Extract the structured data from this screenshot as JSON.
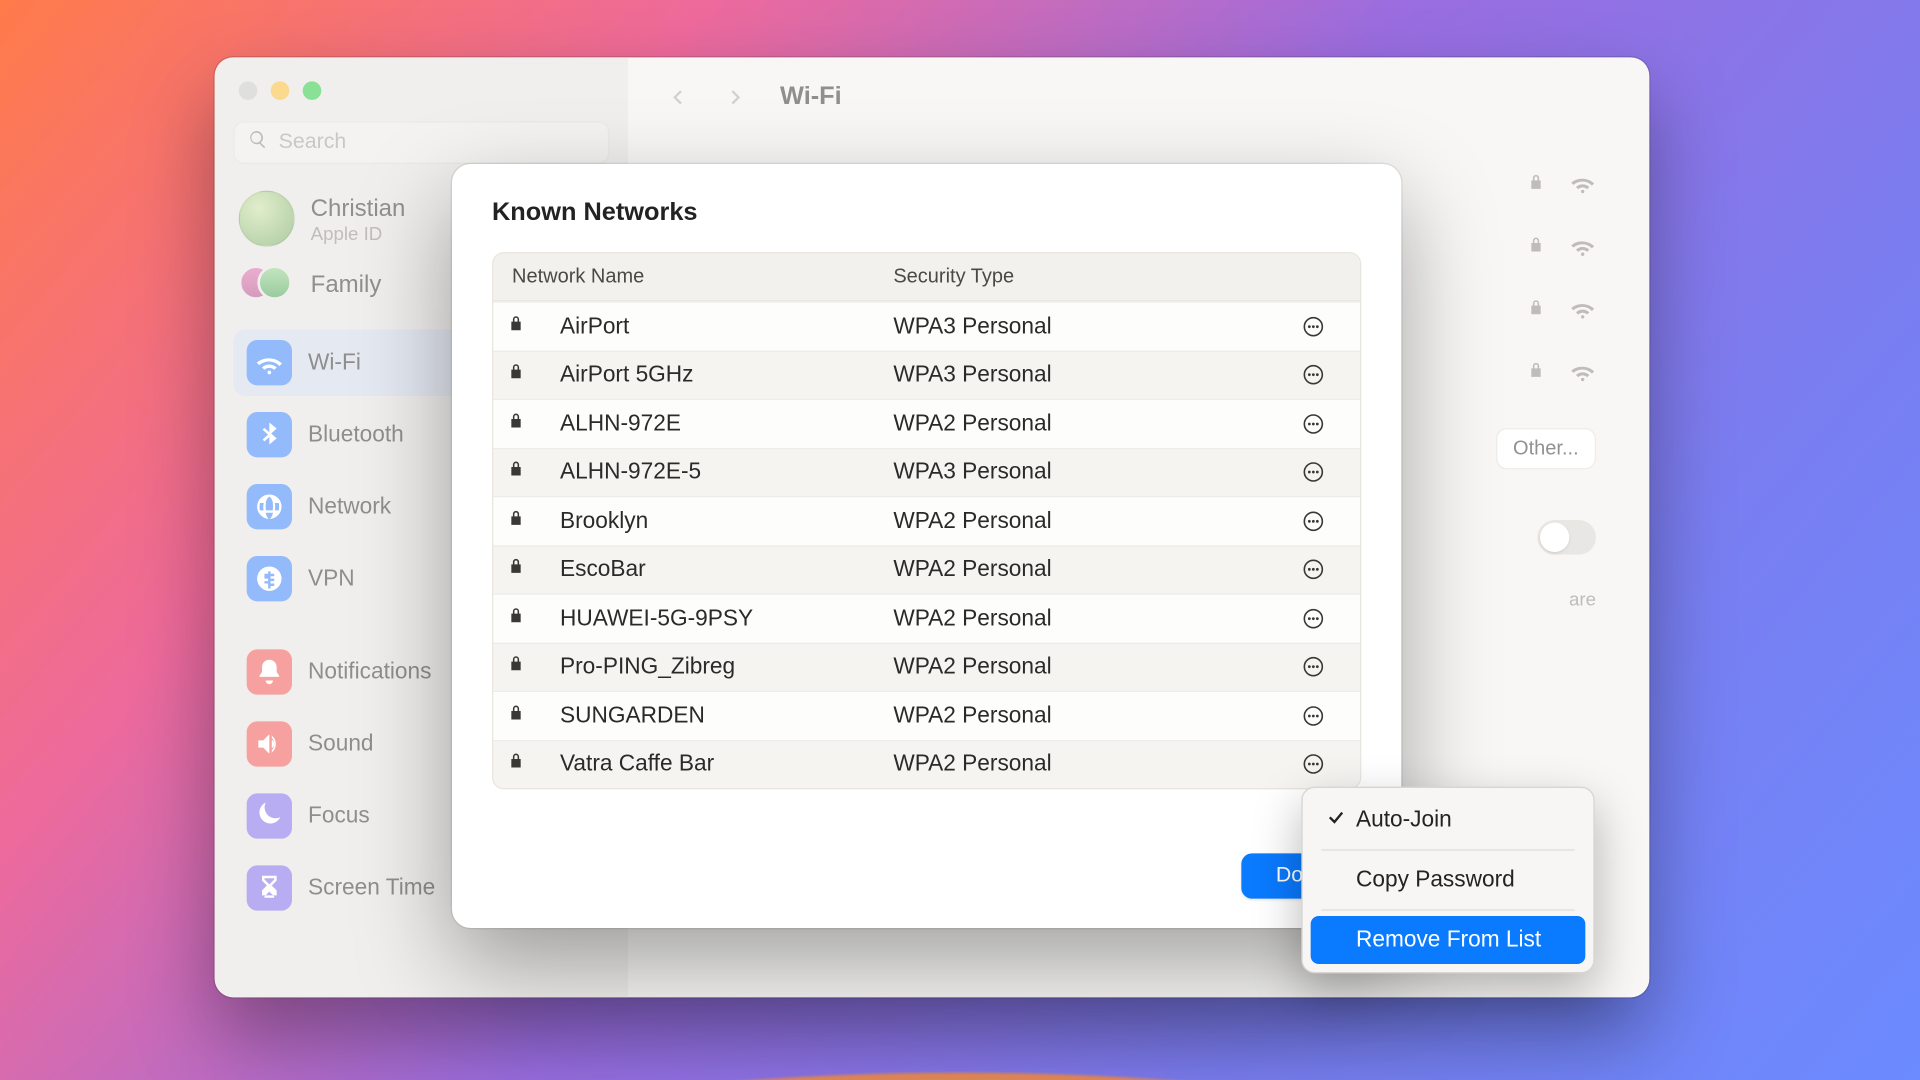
{
  "window": {
    "title": "Wi-Fi",
    "search_placeholder": "Search"
  },
  "user": {
    "name": "Christian",
    "sub": "Apple ID"
  },
  "family_label": "Family",
  "sidebar": {
    "items": [
      {
        "label": "Wi-Fi",
        "icon": "wifi",
        "selected": true
      },
      {
        "label": "Bluetooth",
        "icon": "bt"
      },
      {
        "label": "Network",
        "icon": "net"
      },
      {
        "label": "VPN",
        "icon": "vpn"
      },
      {
        "label": "Notifications",
        "icon": "notif"
      },
      {
        "label": "Sound",
        "icon": "sound"
      },
      {
        "label": "Focus",
        "icon": "focus"
      },
      {
        "label": "Screen Time",
        "icon": "screen"
      }
    ]
  },
  "other_label": "Other...",
  "hint_text": "are",
  "modal": {
    "title": "Known Networks",
    "col_name": "Network Name",
    "col_sec": "Security Type",
    "done_label": "Done",
    "networks": [
      {
        "name": "AirPort",
        "security": "WPA3 Personal"
      },
      {
        "name": "AirPort 5GHz",
        "security": "WPA3 Personal"
      },
      {
        "name": "ALHN-972E",
        "security": "WPA2 Personal"
      },
      {
        "name": "ALHN-972E-5",
        "security": "WPA3 Personal"
      },
      {
        "name": "Brooklyn",
        "security": "WPA2 Personal"
      },
      {
        "name": "EscoBar",
        "security": "WPA2 Personal"
      },
      {
        "name": "HUAWEI-5G-9PSY",
        "security": "WPA2 Personal"
      },
      {
        "name": "Pro-PING_Zibreg",
        "security": "WPA2 Personal"
      },
      {
        "name": "SUNGARDEN",
        "security": "WPA2 Personal"
      },
      {
        "name": "Vatra Caffe Bar",
        "security": "WPA2 Personal"
      }
    ]
  },
  "context_menu": {
    "auto_join": "Auto-Join",
    "copy_pw": "Copy Password",
    "remove": "Remove From List"
  }
}
